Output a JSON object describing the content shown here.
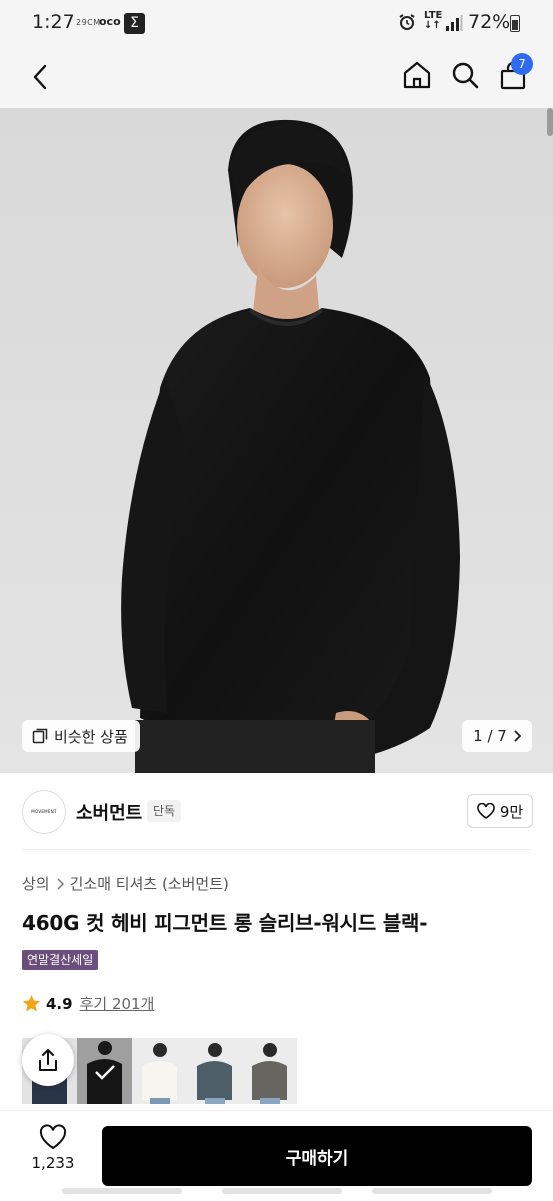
{
  "status_bar": {
    "time": "1:27",
    "small_text": "29CM",
    "app_label": "oco",
    "sigma": "Σ",
    "network": "LTE",
    "battery": "72%"
  },
  "header": {
    "cart_count": "7"
  },
  "gallery": {
    "similar_label": "비슷한 상품",
    "page_indicator": "1 / 7"
  },
  "brand": {
    "logo_text": "MOVEMENT",
    "name": "소버먼트",
    "tag": "단독",
    "likes": "9만"
  },
  "product": {
    "breadcrumb": [
      "상의",
      "긴소매 티셔츠 (소버먼트)"
    ],
    "title": "460G 컷 헤비 피그먼트 롱 슬리브-워시드 블랙-",
    "sale_badge": "연말결산세일",
    "rating": "4.9",
    "review_link": "후기 201개"
  },
  "bottom": {
    "wish_count": "1,233",
    "buy_label": "구매하기"
  },
  "colors": {
    "accent": "#2f6bf2",
    "sale_badge": "#6b4e7b",
    "star": "#f2a516",
    "buy_button": "#000000"
  }
}
